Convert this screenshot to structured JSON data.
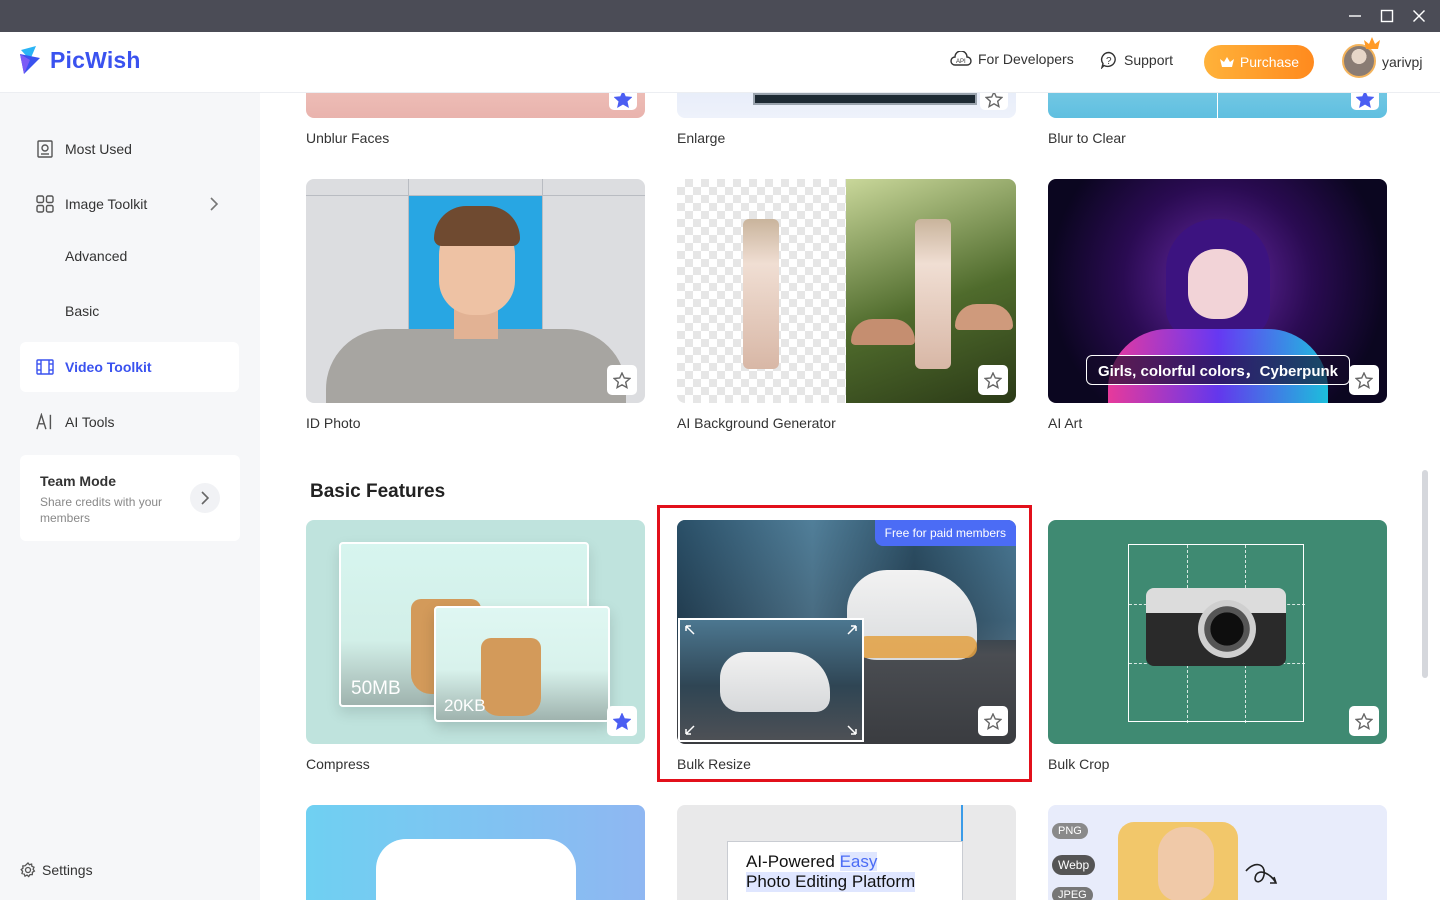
{
  "window": {
    "controls": [
      "minimize-icon",
      "maximize-icon",
      "close-icon"
    ]
  },
  "header": {
    "app_name": "PicWish",
    "developers_label": "For Developers",
    "support_label": "Support",
    "purchase_label": "Purchase",
    "username": "yarivpj",
    "accent_color": "#3a52ef",
    "purchase_color": "#ff9a26"
  },
  "sidebar": {
    "most_used": "Most Used",
    "image_toolkit": "Image Toolkit",
    "advanced": "Advanced",
    "basic": "Basic",
    "video_toolkit": "Video Toolkit",
    "ai_tools": "AI Tools",
    "team_title": "Team Mode",
    "team_desc": "Share credits with your members",
    "settings": "Settings"
  },
  "top_row": [
    "Unblur Faces",
    "Enlarge",
    "Blur to Clear"
  ],
  "row2": [
    "ID Photo",
    "AI Background Generator",
    "AI Art"
  ],
  "ai_art_caption": "Girls, colorful colors，Cyberpunk",
  "section_basic": "Basic Features",
  "row3": [
    "Compress",
    "Bulk Resize",
    "Bulk Crop"
  ],
  "compress": {
    "before": "50MB",
    "after": "20KB"
  },
  "bulk_resize_badge": "Free for paid members",
  "row4": {
    "editing_line1": "AI-Powered",
    "editing_word": "Easy",
    "editing_line2": "Photo Editing Platform",
    "formats": [
      "PNG",
      "Webp",
      "JPEG"
    ]
  }
}
